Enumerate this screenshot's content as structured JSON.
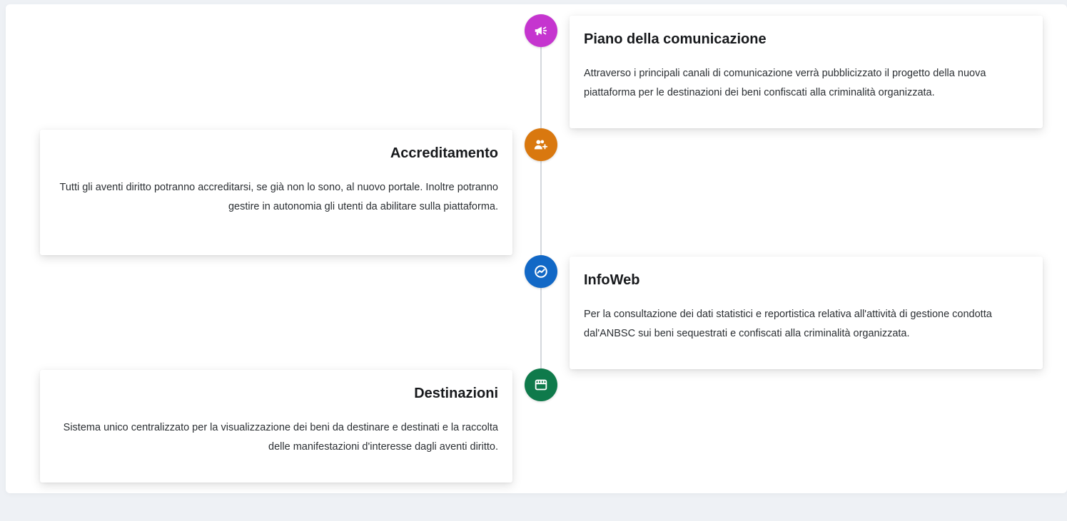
{
  "colors": {
    "piano": "#c535cf",
    "accreditamento": "#d9780f",
    "infoweb": "#1268c6",
    "destinazioni": "#0f7a4b"
  },
  "timeline": [
    {
      "title": "Piano della comunicazione",
      "description": "Attraverso i principali canali di comunicazione verrà pubblicizzato il progetto della nuova piattaforma per le destinazioni dei beni confiscati alla criminalità organizzata.",
      "icon": "megaphone-icon"
    },
    {
      "title": "Accreditamento",
      "description": "Tutti gli aventi diritto potranno accreditarsi, se già non lo sono, al nuovo portale. Inoltre potranno gestire in autonomia gli utenti da abilitare sulla piattaforma.",
      "icon": "user-add-icon"
    },
    {
      "title": "InfoWeb",
      "description": "Per la consultazione dei dati statistici e reportistica relativa all'attività di gestione condotta dal'ANBSC sui beni sequestrati e confiscati alla criminalità organizzata.",
      "icon": "chart-gauge-icon"
    },
    {
      "title": "Destinazioni",
      "description": "Sistema unico centralizzato per la visualizzazione dei beni da destinare e destinati e la raccolta delle manifestazioni d'interesse dagli aventi diritto.",
      "icon": "storefront-icon"
    }
  ]
}
